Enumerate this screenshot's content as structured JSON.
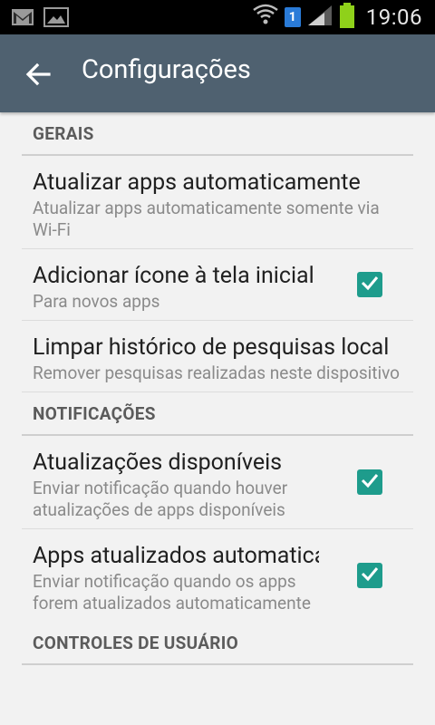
{
  "status_bar": {
    "time": "19:06",
    "sim_number": "1",
    "icons": [
      "gmail-icon",
      "gallery-icon",
      "wifi-icon",
      "signal-icon",
      "battery-icon"
    ]
  },
  "app_bar": {
    "title": "Configurações",
    "back_icon": "arrow-back-icon",
    "background": "#4f6170"
  },
  "sections": {
    "general": {
      "header": "GERAIS",
      "items": [
        {
          "title": "Atualizar apps automaticamente",
          "subtitle": "Atualizar apps automaticamente somente via Wi-Fi"
        },
        {
          "title": "Adicionar ícone à tela inicial",
          "subtitle": "Para novos apps",
          "checked": true
        },
        {
          "title": "Limpar histórico de pesquisas local",
          "subtitle": "Remover pesquisas realizadas neste dispositivo"
        }
      ]
    },
    "notifications": {
      "header": "NOTIFICAÇÕES",
      "items": [
        {
          "title": "Atualizações disponíveis",
          "subtitle": "Enviar notificação quando houver atualizações de apps disponíveis",
          "checked": true
        },
        {
          "title": "Apps atualizados automaticamente",
          "subtitle": "Enviar notificação quando os apps forem atualizados automaticamente",
          "checked": true
        }
      ]
    },
    "user_controls": {
      "header": "CONTROLES DE USUÁRIO"
    }
  },
  "colors": {
    "accent": "#1e9c8c",
    "status_bar": "#000000"
  }
}
